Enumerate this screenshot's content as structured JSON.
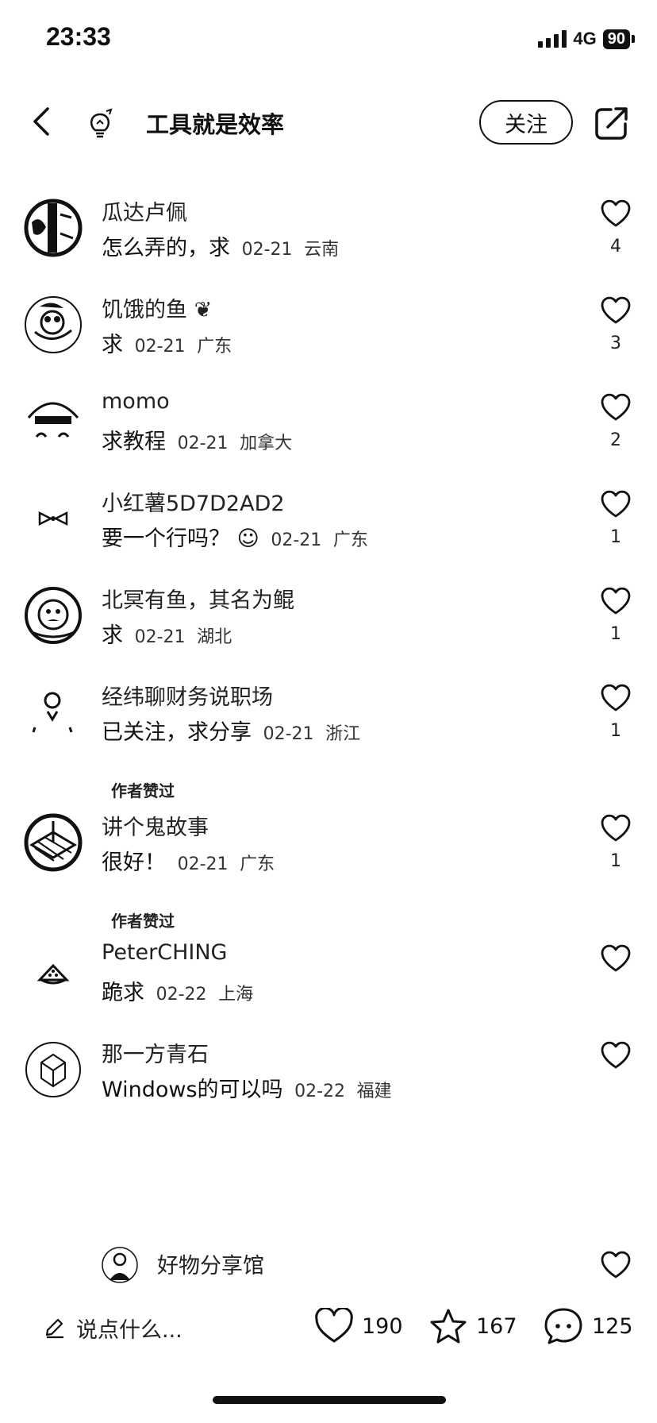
{
  "status_bar": {
    "time": "23:33",
    "network": "4G",
    "battery": "90"
  },
  "nav": {
    "title": "工具就是效率",
    "follow_label": "关注"
  },
  "comments": [
    {
      "name": "瓜达卢佩",
      "text": "怎么弄的，求",
      "date": "02-21",
      "location": "云南",
      "likes": "4",
      "author_liked": ""
    },
    {
      "name": "饥饿的鱼",
      "text": "求",
      "date": "02-21",
      "location": "广东",
      "likes": "3",
      "author_liked": ""
    },
    {
      "name": "momo",
      "text": "求教程",
      "date": "02-21",
      "location": "加拿大",
      "likes": "2",
      "author_liked": ""
    },
    {
      "name": "小红薯5D7D2AD2",
      "text": "要一个行吗？",
      "date": "02-21",
      "location": "广东",
      "likes": "1",
      "author_liked": ""
    },
    {
      "name": "北冥有鱼，其名为鲲",
      "text": "求",
      "date": "02-21",
      "location": "湖北",
      "likes": "1",
      "author_liked": ""
    },
    {
      "name": "经纬聊财务说职场",
      "text": "已关注，求分享",
      "date": "02-21",
      "location": "浙江",
      "likes": "1",
      "author_liked": "作者赞过"
    },
    {
      "name": "讲个鬼故事",
      "text": "很好！",
      "date": "02-21",
      "location": "广东",
      "likes": "1",
      "author_liked": "作者赞过"
    },
    {
      "name": "PeterCHING",
      "text": "跪求",
      "date": "02-22",
      "location": "上海",
      "likes": "",
      "author_liked": ""
    },
    {
      "name": "那一方青石",
      "text": "Windows的可以吗",
      "date": "02-22",
      "location": "福建",
      "likes": "",
      "author_liked": ""
    }
  ],
  "reply_preview": {
    "name": "好物分享馆"
  },
  "bottom_bar": {
    "input_placeholder": "说点什么...",
    "likes": "190",
    "favorites": "167",
    "comments": "125"
  }
}
